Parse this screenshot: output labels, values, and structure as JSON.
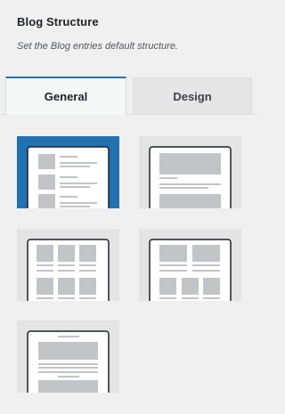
{
  "panel": {
    "title": "Blog Structure",
    "description": "Set the Blog entries default structure."
  },
  "tabs": [
    {
      "label": "General",
      "active": true
    },
    {
      "label": "Design",
      "active": false
    }
  ],
  "layouts": [
    {
      "name": "list-thumbnails",
      "selected": true
    },
    {
      "name": "single-column-large",
      "selected": false
    },
    {
      "name": "grid-three-columns",
      "selected": false
    },
    {
      "name": "grid-mixed",
      "selected": false
    },
    {
      "name": "single-column-title-top",
      "selected": false
    }
  ],
  "colors": {
    "accent": "#2271b1",
    "tile_bg": "#e4e4e5",
    "panel_bg": "#f0f0f1"
  }
}
